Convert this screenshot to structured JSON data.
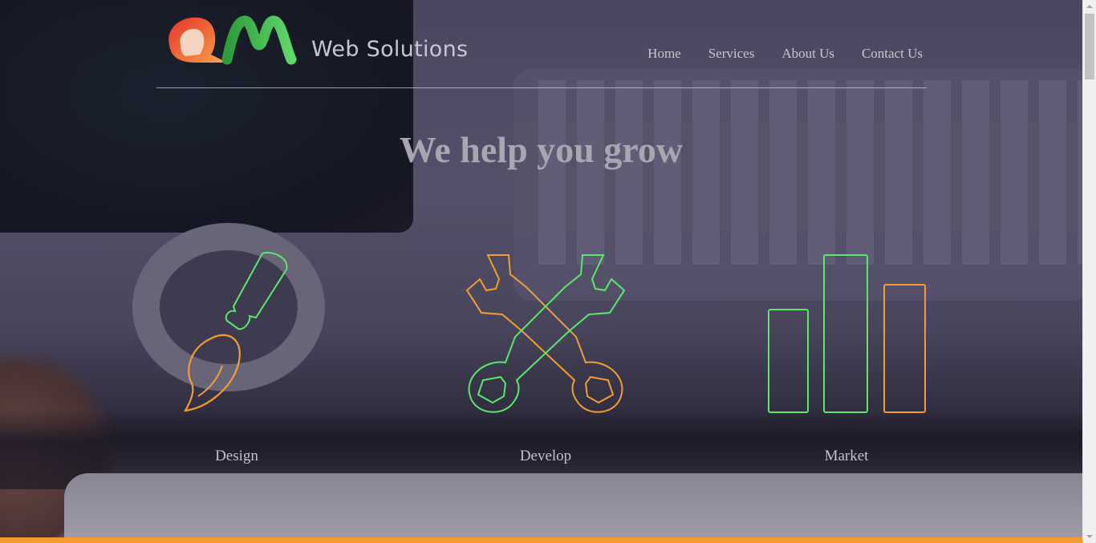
{
  "brand": {
    "name": "Web Solutions"
  },
  "nav": {
    "items": [
      "Home",
      "Services",
      "About Us",
      "Contact Us"
    ]
  },
  "hero": {
    "title": "We help you grow"
  },
  "features": [
    {
      "label": "Design",
      "icon": "paintbrush-icon"
    },
    {
      "label": "Develop",
      "icon": "crossed-wrenches-icon"
    },
    {
      "label": "Market",
      "icon": "bar-chart-icon"
    }
  ],
  "colors": {
    "accent_green": "#5be86a",
    "accent_orange": "#f39c32",
    "bottom_bar": "#f59a32"
  }
}
